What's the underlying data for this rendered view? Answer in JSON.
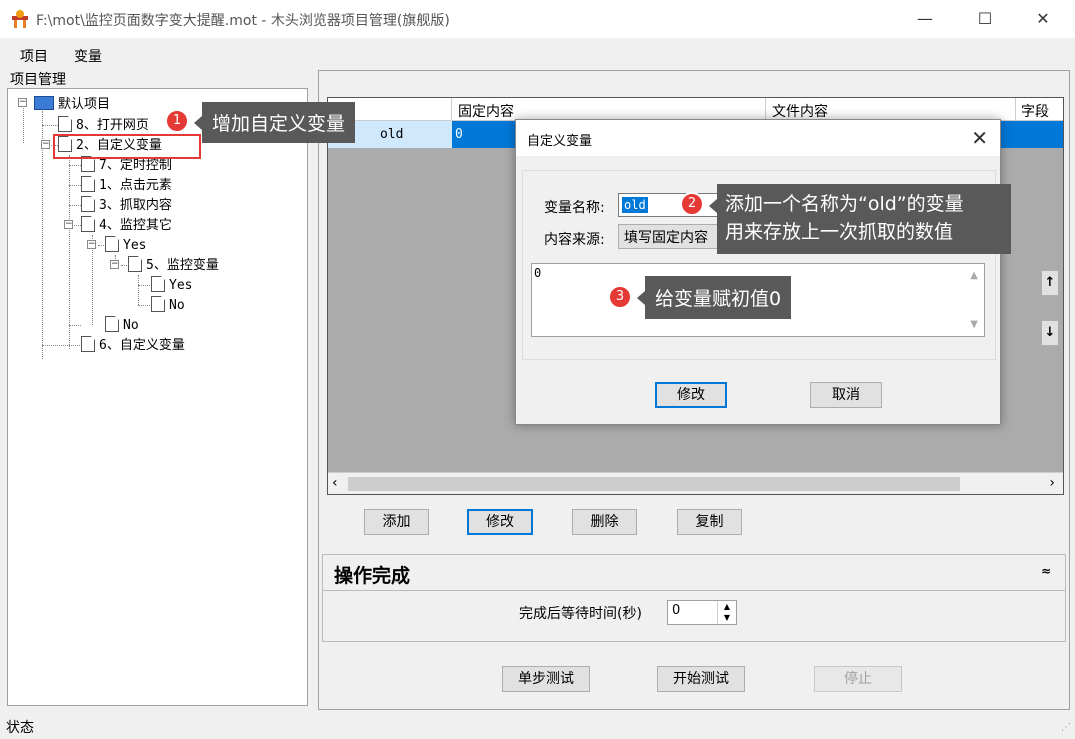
{
  "window": {
    "title": "F:\\mot\\监控页面数字变大提醒.mot  - 木头浏览器项目管理(旗舰版)",
    "minimize": "—",
    "maximize": "☐",
    "close": "✕"
  },
  "menu": {
    "items": [
      "项目",
      "变量"
    ]
  },
  "tree_panel": {
    "label": "项目管理",
    "items": [
      "默认项目",
      "8、打开网页",
      "2、自定义变量",
      "7、定时控制",
      "1、点击元素",
      "3、抓取内容",
      "4、监控其它",
      "Yes",
      "5、监控变量",
      "Yes",
      "No",
      "No",
      "6、自定义变量"
    ]
  },
  "grid": {
    "columns": [
      "",
      "固定内容",
      "文件内容",
      "字段"
    ],
    "rows": [
      {
        "name": "old",
        "fixed": "0"
      }
    ]
  },
  "action_buttons": {
    "add": "添加",
    "edit": "修改",
    "delete": "删除",
    "copy": "复制"
  },
  "side_arrows": {
    "up": "↑",
    "down": "↓"
  },
  "operation": {
    "title": "操作完成",
    "collapse": "≈",
    "wait_label": "完成后等待时间(秒)",
    "wait_value": "0"
  },
  "test_buttons": {
    "step": "单步测试",
    "start": "开始测试",
    "stop": "停止"
  },
  "status": {
    "label": "状态"
  },
  "dialog": {
    "title": "自定义变量",
    "close": "✕",
    "name_label": "变量名称:",
    "name_value": "old",
    "source_label": "内容来源:",
    "source_value": "填写固定内容",
    "content_value": "0",
    "ok": "修改",
    "cancel": "取消"
  },
  "callouts": [
    {
      "num": "1",
      "text": "增加自定义变量"
    },
    {
      "num": "2",
      "line1": "添加一个名称为“old”的变量",
      "line2": "用来存放上一次抓取的数值"
    },
    {
      "num": "3",
      "text": "给变量赋初值0"
    }
  ],
  "colors": {
    "selection": "#0078d7",
    "callout": "#595959",
    "marker": "#e53935"
  }
}
